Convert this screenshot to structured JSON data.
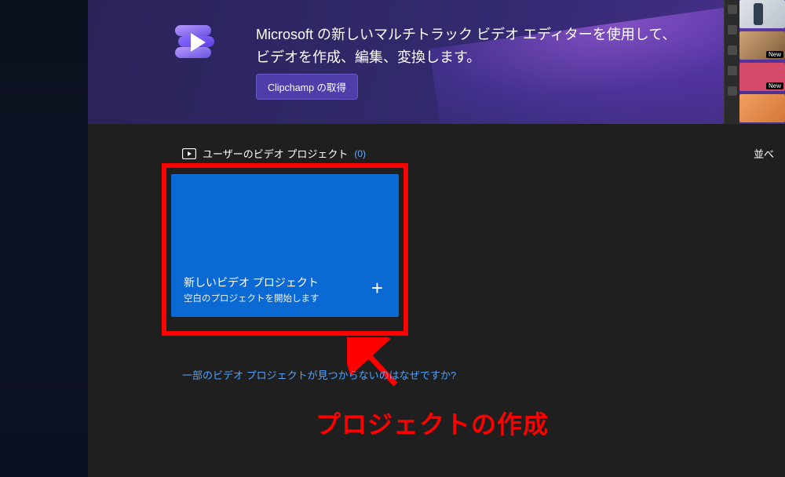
{
  "promo": {
    "headline": "Microsoft の新しいマルチトラック ビデオ エディターを使用して、ビデオを作成、編集、変換します。",
    "button": "Clipchamp の取得",
    "icon_name": "clipchamp-icon"
  },
  "section": {
    "title": "ユーザーのビデオ プロジェクト",
    "count": "(0)",
    "sort_label": "並べ"
  },
  "new_project_tile": {
    "title": "新しいビデオ プロジェクト",
    "subtitle": "空白のプロジェクトを開始します",
    "plus": "+"
  },
  "help_link": "一部のビデオ プロジェクトが見つからないのはなぜですか?",
  "annotation": {
    "caption": "プロジェクトの作成",
    "highlight_color": "#ff0000",
    "arrow_color": "#ff0000"
  },
  "thumbnails": [
    {
      "badge": ""
    },
    {
      "badge": "New"
    },
    {
      "badge": "New"
    },
    {
      "badge": ""
    }
  ],
  "colors": {
    "tile_bg": "#0b69d3",
    "link": "#4da2ff",
    "promo_btn": "#4f3ea9"
  }
}
